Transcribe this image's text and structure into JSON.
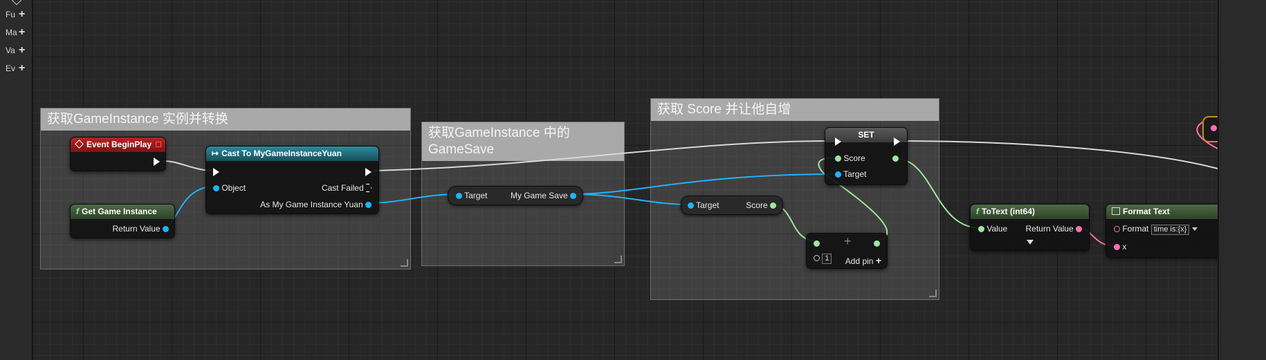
{
  "sidebar": {
    "items": [
      {
        "label": "Fu"
      },
      {
        "label": "Ma"
      },
      {
        "label": "Va"
      },
      {
        "label": "Ev"
      }
    ],
    "add_symbol": "+"
  },
  "comments": [
    {
      "title": "获取GameInstance 实例并转换"
    },
    {
      "title": "获取GameInstance 中的 GameSave"
    },
    {
      "title": "获取 Score 并让他自增"
    }
  ],
  "nodes": {
    "begin_play": {
      "title": "Event BeginPlay"
    },
    "get_game_instance": {
      "title": "Get Game Instance",
      "return_value": "Return Value"
    },
    "cast": {
      "title": "Cast To MyGameInstanceYuan",
      "object": "Object",
      "cast_failed": "Cast Failed",
      "as_output": "As My Game Instance Yuan"
    },
    "get_game_save": {
      "target": "Target",
      "output": "My Game Save"
    },
    "get_score": {
      "target": "Target",
      "output": "Score"
    },
    "set": {
      "title": "SET",
      "score": "Score",
      "target": "Target"
    },
    "add": {
      "value": "1",
      "add_pin": "Add pin",
      "plus_symbol": "+"
    },
    "to_text": {
      "title": "ToText (int64)",
      "value": "Value",
      "return_value": "Return Value"
    },
    "format_text": {
      "title": "Format Text",
      "format_label": "Format",
      "format_value": "time is:{x}",
      "x": "x"
    }
  },
  "colors": {
    "object_pin": "#1fb3ff",
    "int_pin": "#9fe6a0",
    "text_pin": "#ff6fae",
    "event_header": "#9b1c1c",
    "cast_header": "#1f6a7a",
    "pure_header": "#3d5a3a"
  }
}
